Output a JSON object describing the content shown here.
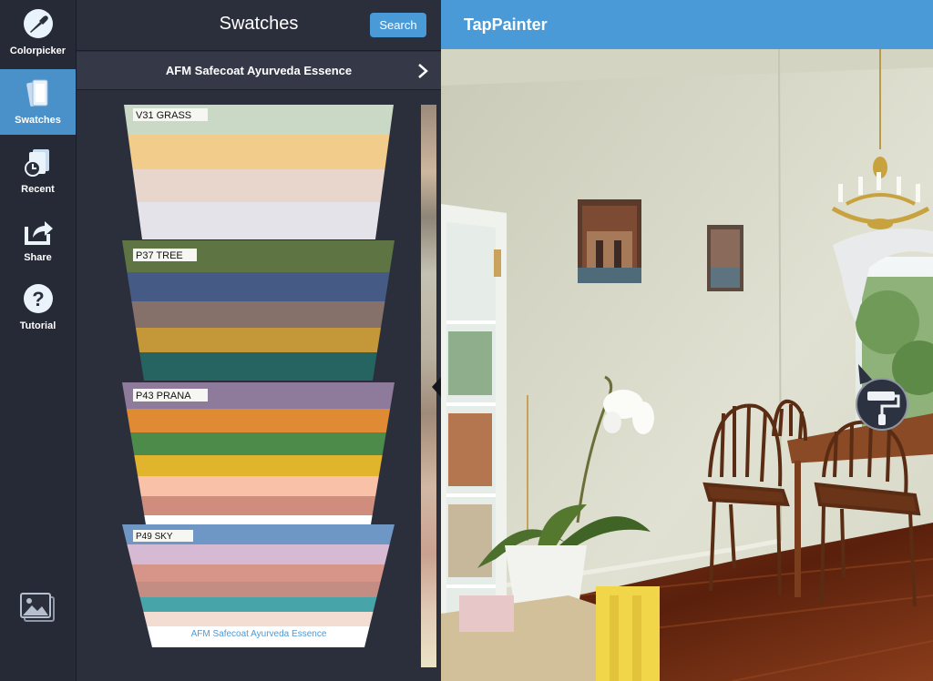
{
  "nav": {
    "items": [
      {
        "label": "Colorpicker",
        "icon": "eyedropper-icon"
      },
      {
        "label": "Swatches",
        "icon": "swatch-cards-icon"
      },
      {
        "label": "Recent",
        "icon": "recent-clock-icon"
      },
      {
        "label": "Share",
        "icon": "share-icon"
      },
      {
        "label": "Tutorial",
        "icon": "question-icon"
      }
    ],
    "active": "Swatches",
    "gallery_icon": "photo-gallery-icon"
  },
  "panel": {
    "title": "Swatches",
    "search_label": "Search",
    "collection_name": "AFM Safecoat Ayurveda Essence",
    "collection_chevron": "chevron-right-icon"
  },
  "swatch_cards": [
    {
      "name": "V31 GRASS",
      "colors": [
        "#cad8c6",
        "#f1cc8a",
        "#e8d6cc",
        "#e4e3ea"
      ]
    },
    {
      "name": "P37 TREE",
      "colors": [
        "#5e7443",
        "#465a86",
        "#86706a",
        "#c49838",
        "#256461"
      ]
    },
    {
      "name": "P43 PRANA",
      "colors": [
        "#8e7a9a",
        "#e08b33",
        "#4d8b4a",
        "#e0b42c",
        "#f9c1a7",
        "#d08c7c"
      ]
    },
    {
      "name": "P49 SKY",
      "colors": [
        "#6e97c5",
        "#d6b9d3",
        "#d7958a",
        "#c48d83",
        "#47a4a8",
        "#f3ddd2"
      ]
    }
  ],
  "card_footer": "AFM Safecoat Ayurveda Essence",
  "top_bar": {
    "title": "TapPainter"
  },
  "tools": {
    "roller_icon": "paint-roller-icon"
  },
  "colors": {
    "accent": "#4a9ad8",
    "nav_bg": "#262a37",
    "panel_bg": "#2b2f3c",
    "wall": "#d8d9c9"
  }
}
